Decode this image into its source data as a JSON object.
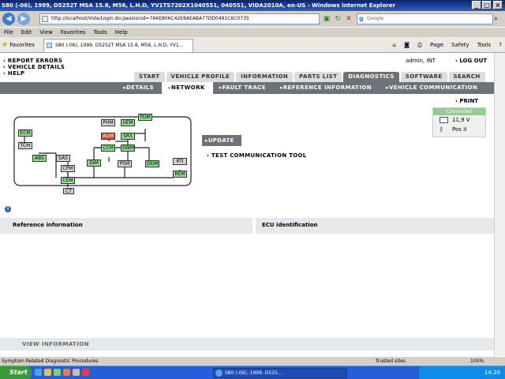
{
  "window": {
    "title": "S80 (-06), 1999, D5252T MSA 15.8, M56, L.H.D, YV1TS7202X1040551, 040551, VIDA2010A, en-US - Windows Internet Explorer"
  },
  "address": {
    "url": "http://localhost/Vida/Login.do;jsessionid=7A6E806C42E8AEABA77DD0491C6C0735",
    "search_placeholder": "Google"
  },
  "menubar": [
    "File",
    "Edit",
    "View",
    "Favorites",
    "Tools",
    "Help"
  ],
  "favorites": {
    "label": "Favorites",
    "tab_title": "S80 (-06), 1999, D5252T MSA 15.8, M56, L.H.D, YV1...",
    "commands": [
      "Page",
      "Safety",
      "Tools"
    ]
  },
  "left_menu": [
    "REPORT ERRORS",
    "VEHICLE DETAILS",
    "HELP"
  ],
  "user": "admin, INT",
  "logout": "LOG OUT",
  "main_tabs": [
    {
      "label": "START",
      "active": false
    },
    {
      "label": "VEHICLE PROFILE",
      "active": false
    },
    {
      "label": "INFORMATION",
      "active": false
    },
    {
      "label": "PARTS LIST",
      "active": false
    },
    {
      "label": "DIAGNOSTICS",
      "active": true
    },
    {
      "label": "SOFTWARE",
      "active": false
    },
    {
      "label": "SEARCH",
      "active": false
    }
  ],
  "sub_tabs": [
    {
      "label": "DETAILS",
      "active": false
    },
    {
      "label": "NETWORK",
      "active": true
    },
    {
      "label": "FAULT TRACE",
      "active": false
    },
    {
      "label": "REFERENCE INFORMATION",
      "active": false
    },
    {
      "label": "VEHICLE COMMUNICATION",
      "active": false
    }
  ],
  "network_nodes": [
    {
      "label": "ECM",
      "state": "green"
    },
    {
      "label": "TCM",
      "state": "gray"
    },
    {
      "label": "ABS",
      "state": "green"
    },
    {
      "label": "SAS",
      "state": "gray"
    },
    {
      "label": "CPM",
      "state": "gray"
    },
    {
      "label": "CEM",
      "state": "green"
    },
    {
      "label": "CT",
      "state": "gray"
    },
    {
      "label": "PHM",
      "state": "gray"
    },
    {
      "label": "UEM",
      "state": "green"
    },
    {
      "label": "PDM",
      "state": "green"
    },
    {
      "label": "AUM",
      "state": "red"
    },
    {
      "label": "SRS",
      "state": "green"
    },
    {
      "label": "CCM",
      "state": "green"
    },
    {
      "label": "SWM",
      "state": "green"
    },
    {
      "label": "DIM",
      "state": "green"
    },
    {
      "label": "PSM",
      "state": "gray"
    },
    {
      "label": "DDM",
      "state": "green"
    },
    {
      "label": "RTI",
      "state": "gray"
    },
    {
      "label": "REM",
      "state": "green"
    }
  ],
  "update_button": "UPDATE",
  "test_comm_link": "TEST COMMUNICATION TOOL",
  "print_link": "PRINT",
  "vehicle_status": {
    "connection": "Connected",
    "voltage": "11,9 V",
    "ignition": "Pos II"
  },
  "panels": {
    "reference": "Reference information",
    "ecu": "ECU identification",
    "view_info": "VIEW INFORMATION"
  },
  "statusbar": {
    "text": "Symptom Related Diagnostic Procedures",
    "zone": "Trusted sites",
    "zoom": "100%"
  },
  "taskbar": {
    "start": "Start",
    "task_item": "S80 (-06), 1999, D525...",
    "clock": "14:20"
  },
  "colors": {
    "tab_active": "#6d7278",
    "node_green": "#8fe08f",
    "node_gray": "#d4d4d4",
    "node_red": "#e84a2a",
    "accent_orange": "#e98300"
  }
}
